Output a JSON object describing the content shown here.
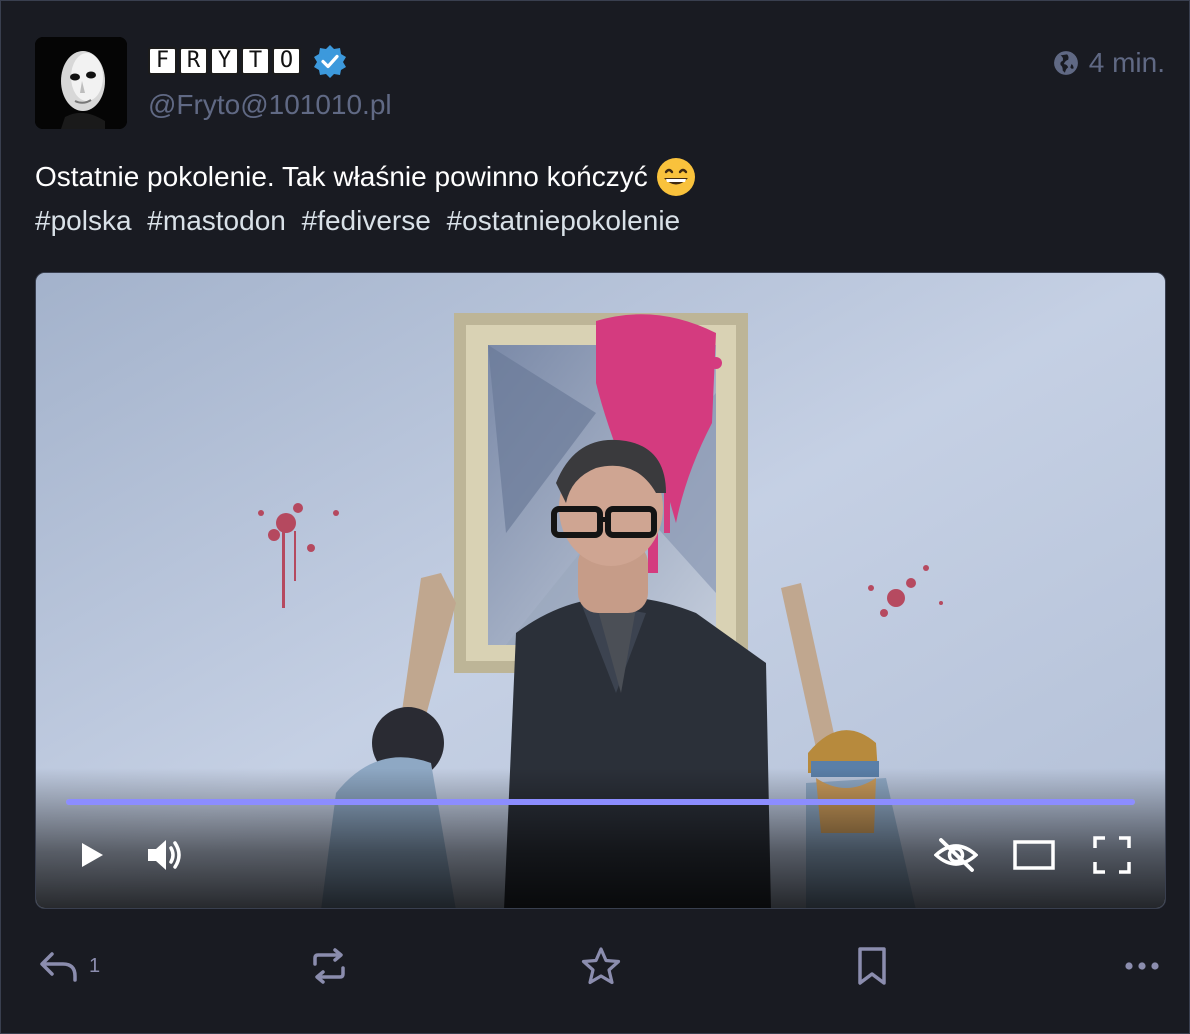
{
  "post": {
    "display_name_letters": [
      "F",
      "R",
      "Y",
      "T",
      "O"
    ],
    "handle": "@Fryto@101010.pl",
    "timestamp": "4 min.",
    "visibility_icon": "globe-icon",
    "verified_icon": "verified-badge-icon",
    "text": "Ostatnie pokolenie. Tak właśnie powinno kończyć",
    "emoji": "grinning-face-icon",
    "hashtags": [
      "#polska",
      "#mastodon",
      "#fediverse",
      "#ostatniepokolenie"
    ]
  },
  "video": {
    "progress_fraction": 1.0,
    "controls": [
      "play-icon",
      "volume-icon",
      "hide-media-icon",
      "theater-mode-icon",
      "fullscreen-icon"
    ],
    "accent_color": "#8c8dff"
  },
  "actions": {
    "reply_count": "1",
    "icons": [
      "reply-icon",
      "boost-icon",
      "favourite-icon",
      "bookmark-icon",
      "more-icon"
    ]
  },
  "colors": {
    "background": "#191b22",
    "muted": "#606984",
    "action": "#8b8dae",
    "verified": "#3c99dc"
  }
}
